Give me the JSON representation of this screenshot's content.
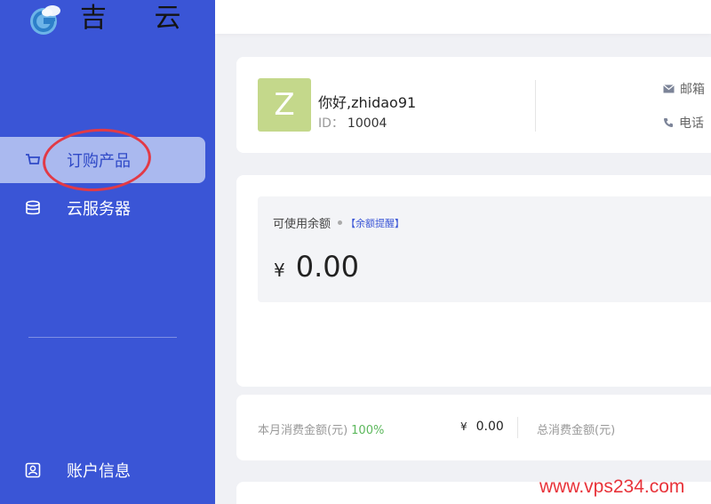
{
  "brand": {
    "name": "吉 云",
    "logo_icon": "cloud-g-logo",
    "accent": "#3a55d6"
  },
  "sidebar": {
    "items": [
      {
        "label": "订购产品",
        "icon": "cart-icon",
        "active": true
      },
      {
        "label": "云服务器",
        "icon": "database-icon",
        "active": false
      },
      {
        "label": "账户信息",
        "icon": "user-card-icon",
        "active": false
      }
    ]
  },
  "user": {
    "avatar_letter": "Z",
    "greeting": "你好,zhidao91",
    "id_label": "ID：",
    "id_value": "10004",
    "email_label": "邮箱",
    "phone_label": "电话"
  },
  "balance": {
    "title": "可使用余额",
    "reminder_link": "【余额提醒】",
    "currency": "¥",
    "amount": "0.00"
  },
  "stats": {
    "month_label": "本月消费金额(元)",
    "month_percent": "100%",
    "month_currency": "¥",
    "month_value": "0.00",
    "total_label": "总消费金额(元)"
  },
  "watermark": "www.vps234.com"
}
